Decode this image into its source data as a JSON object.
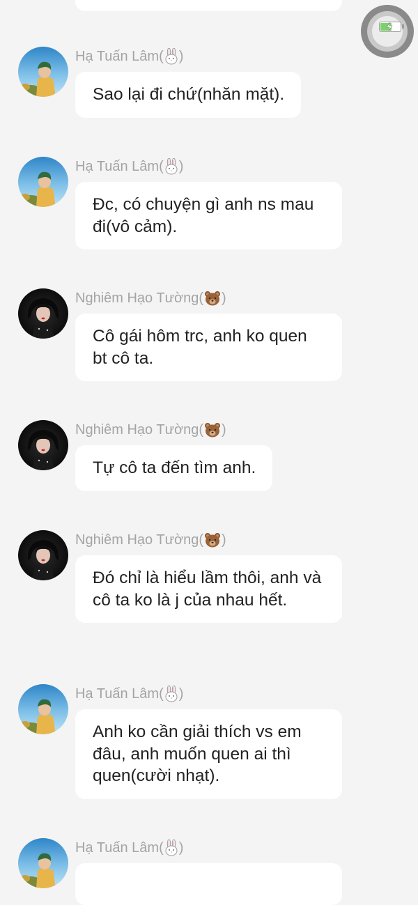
{
  "colors": {
    "background": "#f4f4f4",
    "bubble": "#ffffff",
    "sender_name": "#a4a4a4",
    "message_text": "#222222"
  },
  "senders": {
    "ha_tuan_lam": {
      "name": "Hạ Tuấn Lâm(",
      "badge": "rabbit-icon",
      "close": ")"
    },
    "nghiem_hao_tuong": {
      "name": "Nghiêm Hạo Tường(",
      "badge": "bear-icon",
      "close": ")"
    }
  },
  "messages": [
    {
      "sender": "Hạ Tuấn Lâm(",
      "text": "Sao lại đi chứ(nhăn mặt)."
    },
    {
      "sender": "Hạ Tuấn Lâm(",
      "text": "Đc, có chuyện gì anh ns mau đi(vô cảm)."
    },
    {
      "sender": "Nghiêm Hạo Tường(",
      "text": "Cô gái hôm trc, anh ko quen bt cô ta."
    },
    {
      "sender": "Nghiêm Hạo Tường(",
      "text": "Tự cô ta đến tìm anh."
    },
    {
      "sender": "Nghiêm Hạo Tường(",
      "text": "Đó chỉ là hiểu lầm thôi, anh và cô ta ko là j của nhau hết."
    },
    {
      "sender": "Hạ Tuấn Lâm(",
      "text": "Anh ko cần giải thích vs em đâu, anh muốn quen ai thì quen(cười nhạt)."
    },
    {
      "sender": "Hạ Tuấn Lâm(",
      "text": ""
    }
  ],
  "overlay": {
    "assistive_touch": "assistive-touch-button",
    "battery_icon": "battery-charging-icon",
    "battery_level": 0.6
  }
}
